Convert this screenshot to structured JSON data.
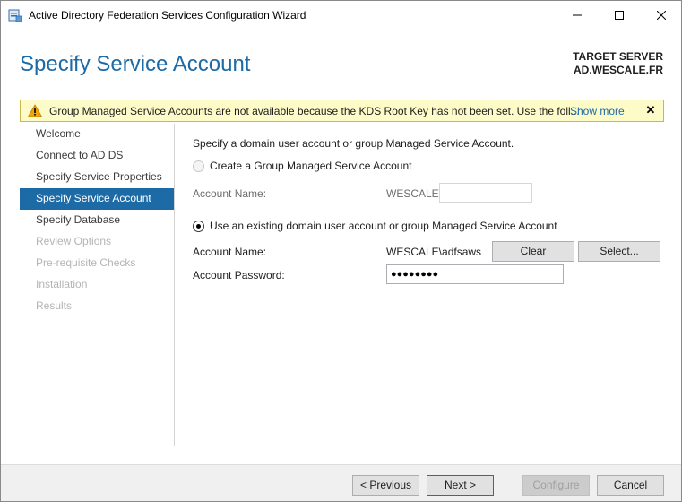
{
  "window": {
    "title": "Active Directory Federation Services Configuration Wizard"
  },
  "header": {
    "page_title": "Specify Service Account",
    "target_server_label": "TARGET SERVER",
    "target_server_name": "AD.WESCALE.FR"
  },
  "warning": {
    "text": "Group Managed Service Accounts are not available because the KDS Root Key has not been set. Use the foll...",
    "show_more": "Show more",
    "close_glyph": "✕"
  },
  "nav": {
    "items": [
      {
        "label": "Welcome",
        "state": "normal"
      },
      {
        "label": "Connect to AD DS",
        "state": "normal"
      },
      {
        "label": "Specify Service Properties",
        "state": "normal"
      },
      {
        "label": "Specify Service Account",
        "state": "active"
      },
      {
        "label": "Specify Database",
        "state": "normal"
      },
      {
        "label": "Review Options",
        "state": "disabled"
      },
      {
        "label": "Pre-requisite Checks",
        "state": "disabled"
      },
      {
        "label": "Installation",
        "state": "disabled"
      },
      {
        "label": "Results",
        "state": "disabled"
      }
    ]
  },
  "main": {
    "intro": "Specify a domain user account or group Managed Service Account.",
    "gmsa_option": {
      "label": "Create a Group Managed Service Account",
      "selected": false,
      "enabled": false,
      "account_name_label": "Account Name:",
      "domain_prefix": "WESCALE\\",
      "account_name_value": ""
    },
    "existing_option": {
      "label": "Use an existing domain user account or group Managed Service Account",
      "selected": true,
      "account_name_label": "Account Name:",
      "account_name_value": "WESCALE\\adfsaws",
      "clear_button": "Clear",
      "select_button": "Select...",
      "password_label": "Account Password:",
      "password_value": "●●●●●●●●"
    }
  },
  "footer": {
    "previous": "< Previous",
    "next": "Next >",
    "configure": "Configure",
    "cancel": "Cancel"
  },
  "colors": {
    "accent": "#1c6aa6",
    "warning_bg": "#fdfbc8",
    "warning_border": "#c9b849"
  }
}
